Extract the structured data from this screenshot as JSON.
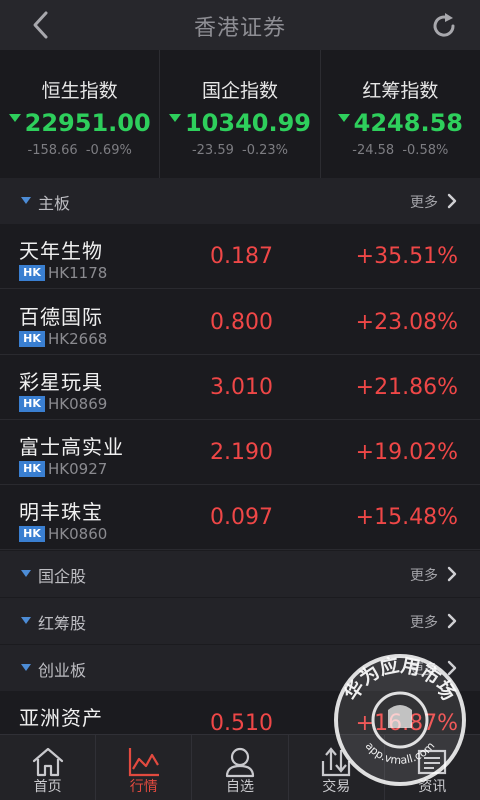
{
  "header": {
    "title": "香港证券"
  },
  "indices": [
    {
      "name": "恒生指数",
      "value": "22951.00",
      "change": "-158.66",
      "pct": "-0.69%"
    },
    {
      "name": "国企指数",
      "value": "10340.99",
      "change": "-23.59",
      "pct": "-0.23%"
    },
    {
      "name": "红筹指数",
      "value": "4248.58",
      "change": "-24.58",
      "pct": "-0.58%"
    }
  ],
  "sections": {
    "main_board": {
      "label": "主板",
      "more": "更多"
    },
    "h_shares": {
      "label": "国企股",
      "more": "更多"
    },
    "red_chips": {
      "label": "红筹股",
      "more": "更多"
    },
    "gem": {
      "label": "创业板",
      "more": "更多"
    }
  },
  "market_tag": "HK",
  "main_board_stocks": [
    {
      "name": "天年生物",
      "code": "HK1178",
      "price": "0.187",
      "pct": "+35.51%"
    },
    {
      "name": "百德国际",
      "code": "HK2668",
      "price": "0.800",
      "pct": "+23.08%"
    },
    {
      "name": "彩星玩具",
      "code": "HK0869",
      "price": "3.010",
      "pct": "+21.86%"
    },
    {
      "name": "富士高实业",
      "code": "HK0927",
      "price": "2.190",
      "pct": "+19.02%"
    },
    {
      "name": "明丰珠宝",
      "code": "HK0860",
      "price": "0.097",
      "pct": "+15.48%"
    }
  ],
  "gem_stocks": [
    {
      "name": "亚洲资产",
      "code": "",
      "price": "0.510",
      "pct": "+16.87%"
    }
  ],
  "tabs": [
    {
      "label": "首页",
      "icon": "home-icon"
    },
    {
      "label": "行情",
      "icon": "chart-icon"
    },
    {
      "label": "自选",
      "icon": "person-icon"
    },
    {
      "label": "交易",
      "icon": "transfer-icon"
    },
    {
      "label": "资讯",
      "icon": "news-icon"
    }
  ],
  "watermark": {
    "text": "华为应用市场",
    "url": "app.vmall.com"
  },
  "colors": {
    "up": "#ef4747",
    "down": "#2ecf5c",
    "accent": "#e24a3f",
    "tag": "#3a7fd1"
  }
}
